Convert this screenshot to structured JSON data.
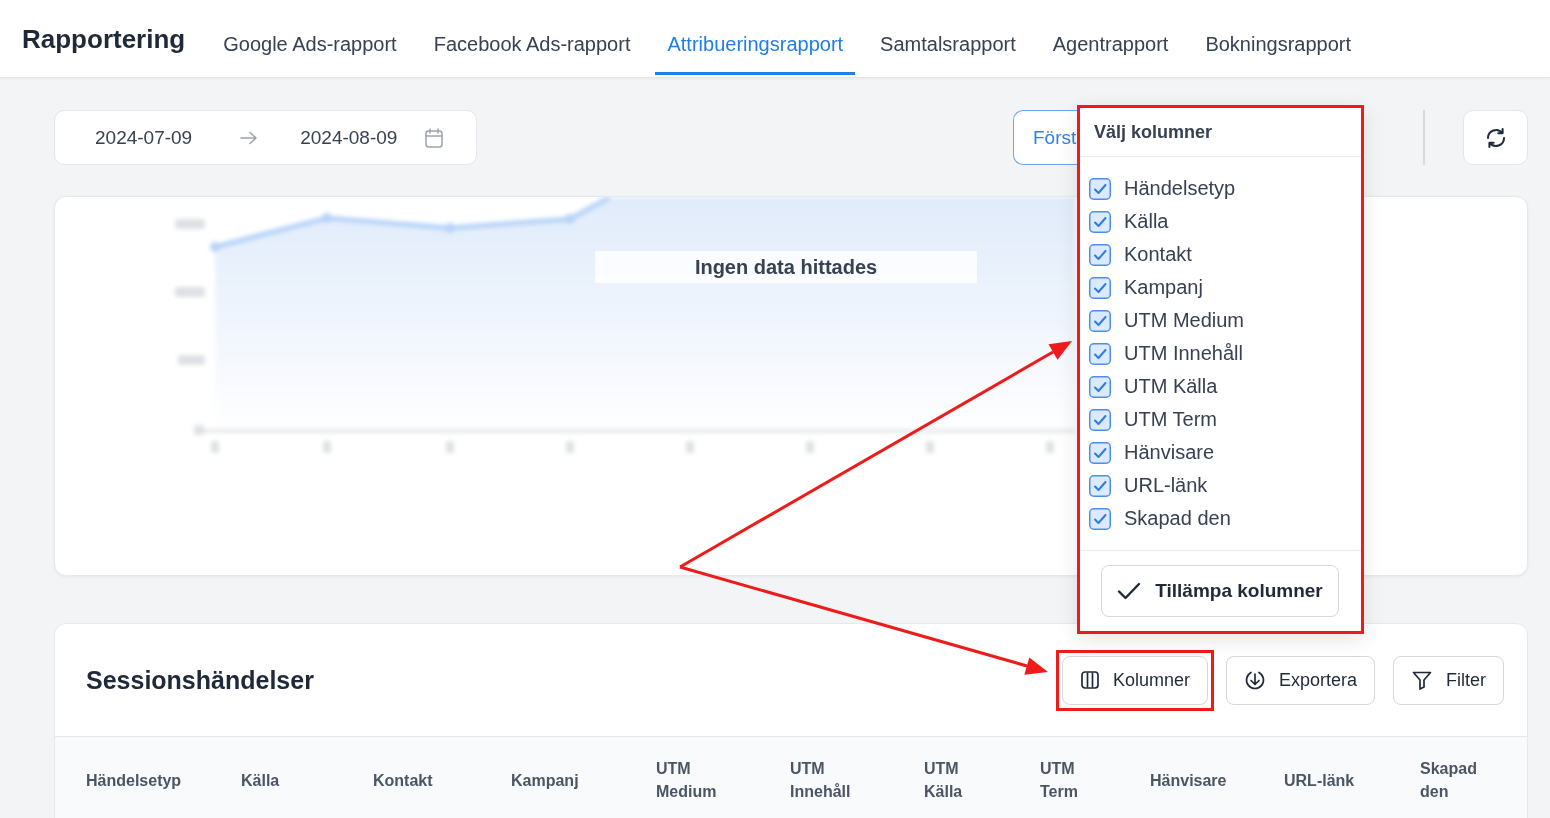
{
  "header": {
    "title": "Rapportering",
    "tabs": [
      {
        "label": "Google Ads-rapport",
        "selected": false
      },
      {
        "label": "Facebook Ads-rapport",
        "selected": false
      },
      {
        "label": "Attribueringsrapport",
        "selected": true
      },
      {
        "label": "Samtalsrapport",
        "selected": false
      },
      {
        "label": "Agentrapport",
        "selected": false
      },
      {
        "label": "Bokningsrapport",
        "selected": false
      }
    ]
  },
  "toolbar": {
    "date_range": {
      "start": "2024-07-09",
      "end": "2024-08-09"
    },
    "model_button": {
      "label": "Först"
    }
  },
  "chart_panel": {
    "empty_message": "Ingen data hittades"
  },
  "column_picker": {
    "title": "Välj kolumner",
    "highlighted": true,
    "options": [
      {
        "label": "Händelsetyp",
        "checked": true
      },
      {
        "label": "Källa",
        "checked": true
      },
      {
        "label": "Kontakt",
        "checked": true
      },
      {
        "label": "Kampanj",
        "checked": true
      },
      {
        "label": "UTM Medium",
        "checked": true
      },
      {
        "label": "UTM Innehåll",
        "checked": true
      },
      {
        "label": "UTM Källa",
        "checked": true
      },
      {
        "label": "UTM Term",
        "checked": true
      },
      {
        "label": "Hänvisare",
        "checked": true
      },
      {
        "label": "URL-länk",
        "checked": true
      },
      {
        "label": "Skapad den",
        "checked": true
      }
    ],
    "apply_button": "Tillämpa kolumner"
  },
  "sessions": {
    "title": "Sessionshändelser",
    "buttons": [
      {
        "kind": "columns",
        "label": "Kolumner",
        "highlighted": true
      },
      {
        "kind": "export",
        "label": "Exportera",
        "highlighted": false
      },
      {
        "kind": "filter",
        "label": "Filter",
        "highlighted": false
      }
    ],
    "table": {
      "columns": [
        "Händelsetyp",
        "Källa",
        "Kontakt",
        "Kampanj",
        "UTM Medium",
        "UTM Innehåll",
        "UTM Källa",
        "UTM Term",
        "Hänvisare",
        "URL-länk",
        "Skapad den"
      ]
    }
  }
}
